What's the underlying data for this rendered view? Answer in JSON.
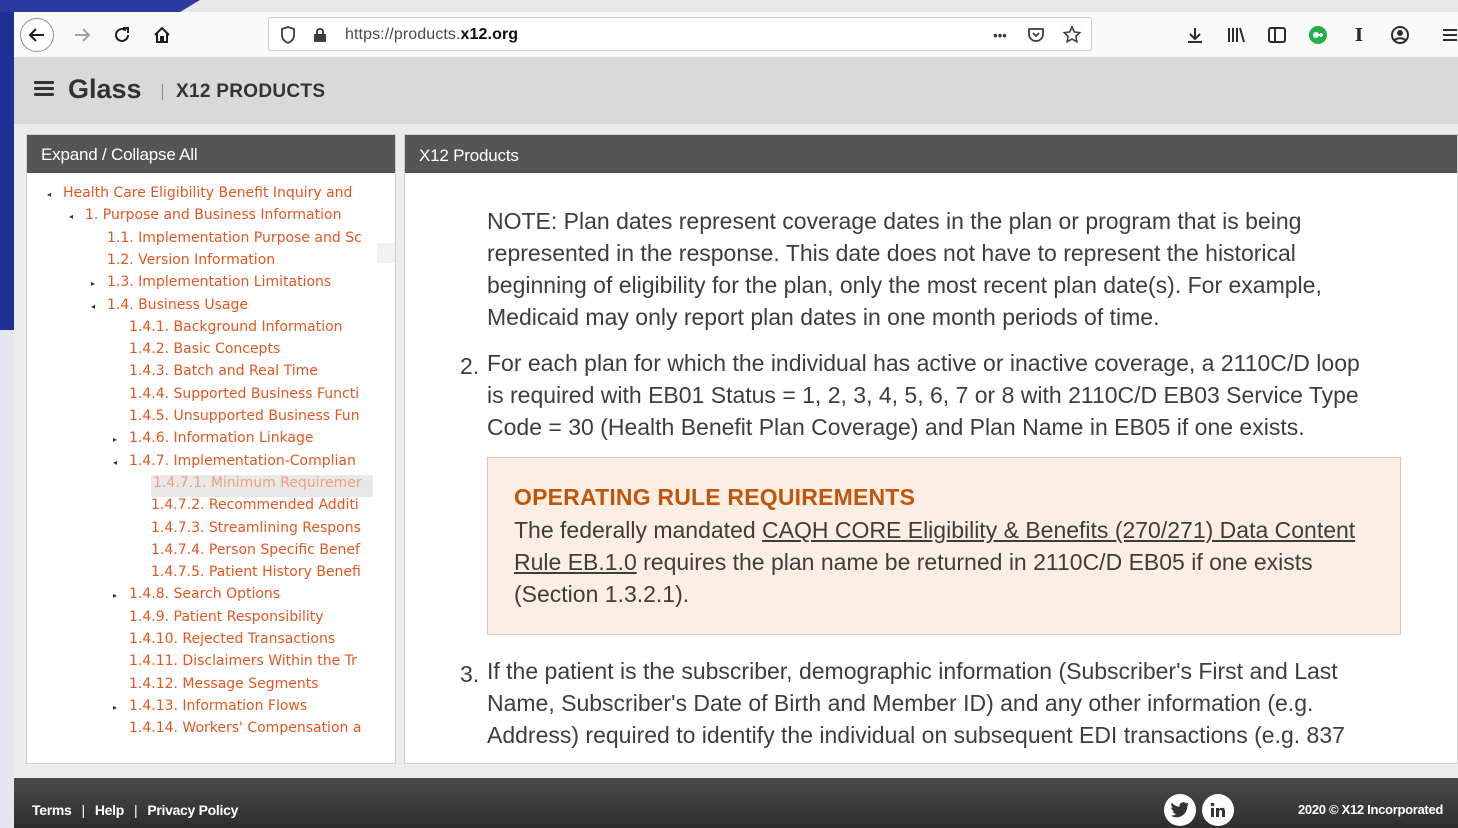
{
  "browser": {
    "url_prefix": "https://products.",
    "url_domain": "x12.org",
    "url_suffix": "",
    "url_menu": "•••"
  },
  "app": {
    "title": "Glass",
    "subtitle": "X12 PRODUCTS"
  },
  "sidebar": {
    "header": "Expand / Collapse All",
    "items": [
      {
        "label": "Health Care Eligibility Benefit Inquiry and",
        "caret": "◂",
        "selected": false
      },
      {
        "label": "1. Purpose and Business Information",
        "caret": "◂",
        "selected": false
      },
      {
        "label": "1.1. Implementation Purpose and Sc",
        "caret": "",
        "selected": false
      },
      {
        "label": "1.2. Version Information",
        "caret": "",
        "selected": false
      },
      {
        "label": "1.3. Implementation Limitations",
        "caret": "▸",
        "selected": false
      },
      {
        "label": "1.4. Business Usage",
        "caret": "◂",
        "selected": false
      },
      {
        "label": "1.4.1. Background Information",
        "caret": "",
        "selected": false
      },
      {
        "label": "1.4.2. Basic Concepts",
        "caret": "",
        "selected": false
      },
      {
        "label": "1.4.3. Batch and Real Time",
        "caret": "",
        "selected": false
      },
      {
        "label": "1.4.4. Supported Business Functi",
        "caret": "",
        "selected": false
      },
      {
        "label": "1.4.5. Unsupported Business Fun",
        "caret": "",
        "selected": false
      },
      {
        "label": "1.4.6. Information Linkage",
        "caret": "▸",
        "selected": false
      },
      {
        "label": "1.4.7. Implementation-Complian",
        "caret": "◂",
        "selected": false
      },
      {
        "label": "1.4.7.1. Minimum Requiremer",
        "caret": "",
        "selected": true
      },
      {
        "label": "1.4.7.2. Recommended Additi",
        "caret": "",
        "selected": false
      },
      {
        "label": "1.4.7.3. Streamlining Respons",
        "caret": "",
        "selected": false
      },
      {
        "label": "1.4.7.4. Person Specific Benef",
        "caret": "",
        "selected": false
      },
      {
        "label": "1.4.7.5. Patient History Benefi",
        "caret": "",
        "selected": false
      },
      {
        "label": "1.4.8. Search Options",
        "caret": "▸",
        "selected": false
      },
      {
        "label": "1.4.9. Patient Responsibility",
        "caret": "",
        "selected": false
      },
      {
        "label": "1.4.10. Rejected Transactions",
        "caret": "",
        "selected": false
      },
      {
        "label": "1.4.11. Disclaimers Within the Tr",
        "caret": "",
        "selected": false
      },
      {
        "label": "1.4.12. Message Segments",
        "caret": "",
        "selected": false
      },
      {
        "label": "1.4.13. Information Flows",
        "caret": "▸",
        "selected": false
      },
      {
        "label": "1.4.14. Workers' Compensation a",
        "caret": "",
        "selected": false
      }
    ]
  },
  "main": {
    "header": "X12 Products",
    "note_lines": [
      "NOTE: Plan dates represent coverage dates in the plan or program that is being",
      "represented in the response. This date does not have to represent the historical",
      "beginning of eligibility for the plan, only the most recent plan date(s). For example,",
      "Medicaid may only report plan dates in one month periods of time."
    ],
    "item2_number": "2.",
    "item2_lines": [
      "For each plan for which the individual has active or inactive coverage, a 2110C/D loop",
      "is required with EB01 Status = 1, 2, 3, 4, 5, 6, 7 or 8 with 2110C/D EB03 Service Type",
      "Code = 30 (Health Benefit Plan Coverage) and Plan Name in EB05 if one exists."
    ],
    "rule_title": "OPERATING RULE REQUIREMENTS",
    "rule_text_1": "The federally mandated ",
    "rule_link": "CAQH CORE Eligibility & Benefits (270/271) Data Content Rule EB.1.0",
    "rule_text_2": " requires the plan name be returned in 2110C/D EB05 if one exists (Section 1.3.2.1).",
    "item3_number": "3.",
    "item3_lines": [
      "If the patient is the subscriber, demographic information (Subscriber's First and Last",
      "Name, Subscriber's Date of Birth and Member ID) and any other information (e.g.",
      "Address) required to identify the individual on subsequent EDI transactions (e.g. 837"
    ]
  },
  "footer": {
    "terms": "Terms",
    "help": "Help",
    "privacy": "Privacy Policy",
    "separator": "|",
    "copyright": "2020 © X12 Incorporated"
  },
  "colors": {
    "tree_link": "#e2571f",
    "rule_title": "#c0560c",
    "rule_bg": "#fdeee3"
  }
}
